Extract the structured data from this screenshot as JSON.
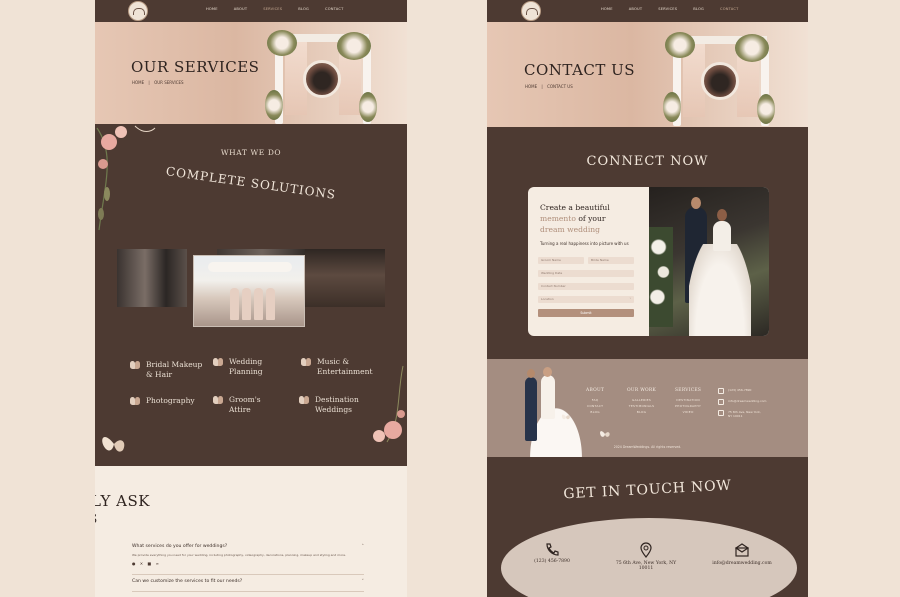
{
  "colors": {
    "brown": "#4d3a32",
    "tan": "#a48d81",
    "cream": "#f5ece2",
    "accent": "#b3907c"
  },
  "left": {
    "nav": [
      {
        "label": "HOME",
        "active": false
      },
      {
        "label": "ABOUT",
        "active": false
      },
      {
        "label": "SERVICES",
        "active": true
      },
      {
        "label": "BLOG",
        "active": false
      },
      {
        "label": "CONTACT",
        "active": false
      }
    ],
    "hero": {
      "title": "OUR SERVICES",
      "crumb_home": "HOME",
      "crumb_sep": "|",
      "crumb_current": "OUR SERVICES"
    },
    "section": {
      "kicker": "WHAT WE DO",
      "title": "COMPLETE SOLUTIONS"
    },
    "services": [
      {
        "label": "Bridal Makeup & Hair",
        "icon": "leaf-icon"
      },
      {
        "label": "Wedding Planning",
        "icon": "leaf-icon"
      },
      {
        "label": "Music & Entertainment",
        "icon": "leaf-icon"
      },
      {
        "label": "Photography",
        "icon": "leaf-icon"
      },
      {
        "label": "Groom's Attire",
        "icon": "leaf-icon"
      },
      {
        "label": "Destination Weddings",
        "icon": "leaf-icon"
      }
    ],
    "faq": {
      "title": "LY ASK",
      "subtitle": "S",
      "items": [
        {
          "question": "What services do you offer for weddings?",
          "answer": "We provide everything you need for your wedding, including photography, videography, decorations, planning, makeup and styling and more."
        },
        {
          "question": "Can we customize the services to fit our needs?"
        }
      ]
    }
  },
  "right": {
    "nav": [
      {
        "label": "HOME",
        "active": false
      },
      {
        "label": "ABOUT",
        "active": false
      },
      {
        "label": "SERVICES",
        "active": false
      },
      {
        "label": "BLOG",
        "active": false
      },
      {
        "label": "CONTACT",
        "active": true
      }
    ],
    "hero": {
      "title": "CONTACT US",
      "crumb_home": "HOME",
      "crumb_sep": "|",
      "crumb_current": "CONTACT US"
    },
    "connect": {
      "title": "CONNECT NOW",
      "heading_line1": "Create a beautiful",
      "heading_line2a": "memento",
      "heading_line2b": "of your",
      "heading_line3": "dream wedding",
      "tagline": "Turning a real happiness into picture with us",
      "fields": {
        "groom_name": "Groom Name",
        "bride_name": "Bride Name",
        "wedding_date": "Wedding Date",
        "contact_number": "Contact Number",
        "location": "Location"
      },
      "submit_label": "Submit"
    },
    "footer": {
      "columns": [
        {
          "title": "ABOUT",
          "items": [
            "FAQ",
            "CONTACT",
            "BLOG"
          ]
        },
        {
          "title": "OUR WORK",
          "items": [
            "GALLERIES",
            "TESTIMONIALS",
            "BLOG"
          ]
        },
        {
          "title": "SERVICES",
          "items": [
            "DESTINATION",
            "PHOTOGRAPHY",
            "VIDEO"
          ]
        }
      ],
      "contact": [
        {
          "text": "(123) 456-7890",
          "icon": "phone-icon"
        },
        {
          "text": "info@dreamwedding.com",
          "icon": "mail-icon"
        },
        {
          "text": "75 6th Ave, New York, NY 10011",
          "icon": "envelope-icon"
        }
      ],
      "copyright": "2024 DreamWeddings. All rights reserved."
    },
    "get_in_touch": {
      "title": "GET IN TOUCH NOW",
      "phone": "(123) 456-7890",
      "address_line1": "75 6th Ave, New York, NY",
      "address_line2": "10011",
      "email": "info@dreamwedding.com"
    }
  }
}
